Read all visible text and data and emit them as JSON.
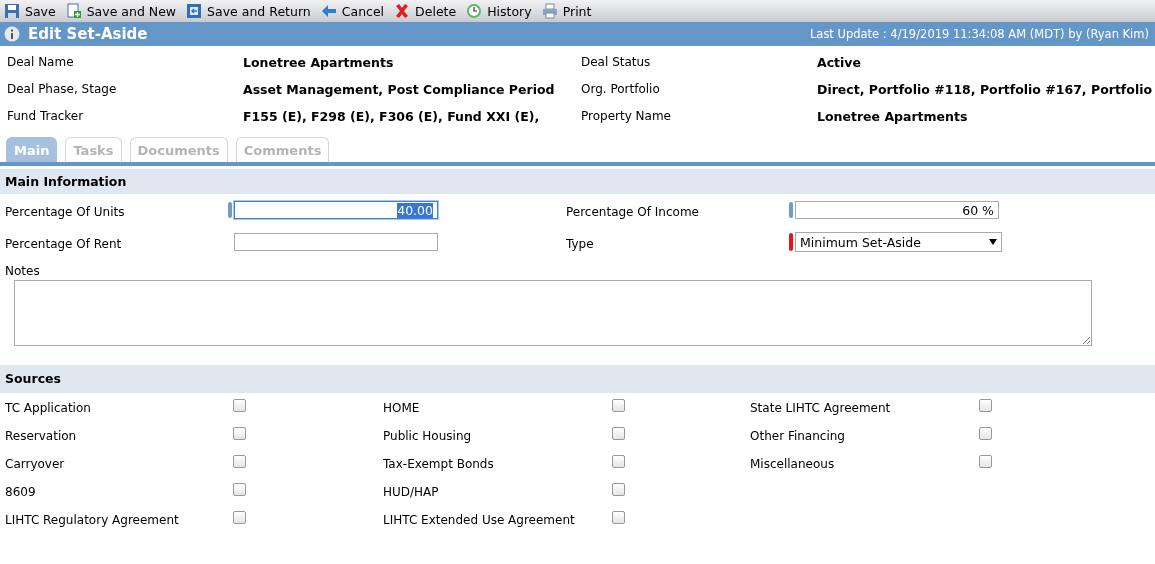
{
  "toolbar": [
    {
      "label": "Save",
      "kind": "save"
    },
    {
      "label": "Save and New",
      "kind": "savenew"
    },
    {
      "label": "Save and Return",
      "kind": "savereturn"
    },
    {
      "label": "Cancel",
      "kind": "cancel"
    },
    {
      "label": "Delete",
      "kind": "delete"
    },
    {
      "label": "History",
      "kind": "history"
    },
    {
      "label": "Print",
      "kind": "print"
    }
  ],
  "header": {
    "title": "Edit Set-Aside",
    "last_update": "Last Update : 4/19/2019 11:34:08 AM (MDT) by (Ryan Kim)"
  },
  "summary": [
    {
      "label": "Deal Name",
      "value": "Lonetree Apartments"
    },
    {
      "label": "Deal Status",
      "value": "Active"
    },
    {
      "label": "Deal Phase, Stage",
      "value": "Asset Management, Post Compliance Period"
    },
    {
      "label": "Org. Portfolio",
      "value": "Direct, Portfolio #118, Portfolio #167, Portfolio"
    },
    {
      "label": "Fund Tracker",
      "value": "F155 (E), F298 (E), F306 (E), Fund XXI (E),"
    },
    {
      "label": "Property Name",
      "value": "Lonetree Apartments"
    }
  ],
  "tabs": [
    {
      "label": "Main",
      "selected": true
    },
    {
      "label": "Tasks",
      "selected": false
    },
    {
      "label": "Documents",
      "selected": false
    },
    {
      "label": "Comments",
      "selected": false
    }
  ],
  "main": {
    "title": "Main Information",
    "fields": [
      {
        "label": "Percentage Of Units",
        "kind": "text",
        "value": "40.00",
        "marked": true,
        "required": false,
        "focused": true
      },
      {
        "label": "Percentage Of Income",
        "kind": "text",
        "value": "60 %",
        "marked": true,
        "required": false,
        "focused": false
      },
      {
        "label": "Percentage Of Rent",
        "kind": "text",
        "marked": false,
        "focused": false
      },
      {
        "label": "Type",
        "kind": "select",
        "value": "Minimum Set-Aside",
        "marked": true,
        "required": true
      }
    ],
    "notes_label": "Notes"
  },
  "sources": {
    "title": "Sources",
    "columns": [
      [
        {
          "label": "TC Application",
          "checked": false
        },
        {
          "label": "Reservation",
          "checked": false
        },
        {
          "label": "Carryover",
          "checked": false
        },
        {
          "label": "8609",
          "checked": false
        },
        {
          "label": "LIHTC Regulatory Agreement",
          "checked": false
        }
      ],
      [
        {
          "label": "HOME",
          "checked": false
        },
        {
          "label": "Public Housing",
          "checked": false
        },
        {
          "label": "Tax-Exempt Bonds",
          "checked": false
        },
        {
          "label": "HUD/HAP",
          "checked": false
        },
        {
          "label": "LIHTC Extended Use Agreement",
          "checked": false
        }
      ],
      [
        {
          "label": "State LIHTC Agreement",
          "checked": false
        },
        {
          "label": "Other Financing",
          "checked": false
        },
        {
          "label": "Miscellaneous",
          "checked": false
        }
      ]
    ]
  }
}
